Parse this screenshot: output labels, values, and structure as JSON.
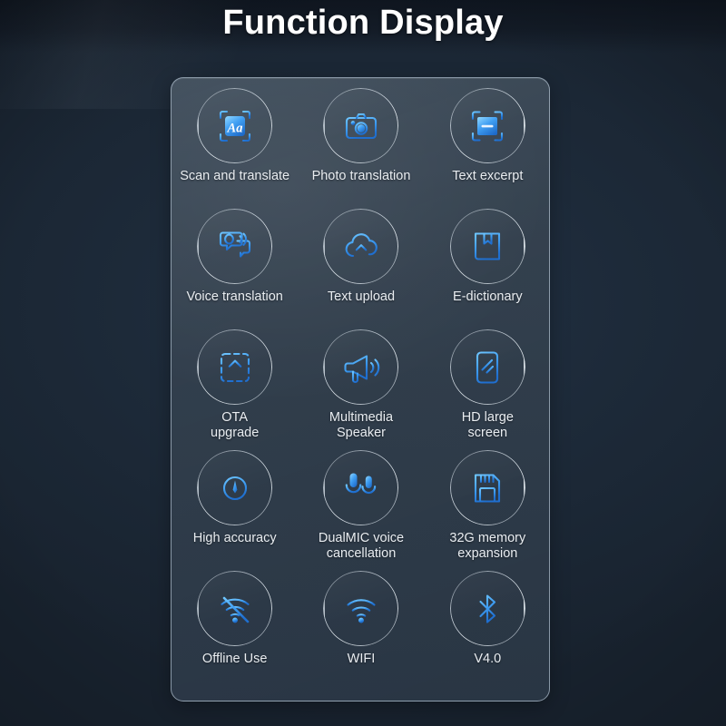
{
  "page": {
    "title": "Function Display",
    "background_color": "#1c2836",
    "panel_border_color": "#c4d4e2",
    "accent_color": "#3d9bf0",
    "label_color": "#e9edf1"
  },
  "grid": {
    "columns": 3,
    "items": [
      {
        "label": "Scan and translate",
        "icon": "scan-text-icon"
      },
      {
        "label": "Photo translation",
        "icon": "camera-icon"
      },
      {
        "label": "Text excerpt",
        "icon": "text-excerpt-icon"
      },
      {
        "label": "Voice translation",
        "icon": "voice-translation-icon"
      },
      {
        "label": "Text upload",
        "icon": "cloud-upload-icon"
      },
      {
        "label": "E-dictionary",
        "icon": "book-bookmark-icon"
      },
      {
        "label": "OTA\nupgrade",
        "icon": "ota-upgrade-icon"
      },
      {
        "label": "Multimedia\nSpeaker",
        "icon": "megaphone-icon"
      },
      {
        "label": "HD large\nscreen",
        "icon": "hd-screen-icon"
      },
      {
        "label": "High accuracy",
        "icon": "crosshair-icon"
      },
      {
        "label": "DualMIC voice\ncancellation",
        "icon": "dual-microphone-icon"
      },
      {
        "label": "32G memory\nexpansion",
        "icon": "memory-card-icon"
      },
      {
        "label": "Offline Use",
        "icon": "wifi-off-icon"
      },
      {
        "label": "WIFI",
        "icon": "wifi-icon"
      },
      {
        "label": "V4.0",
        "icon": "bluetooth-icon"
      }
    ]
  }
}
